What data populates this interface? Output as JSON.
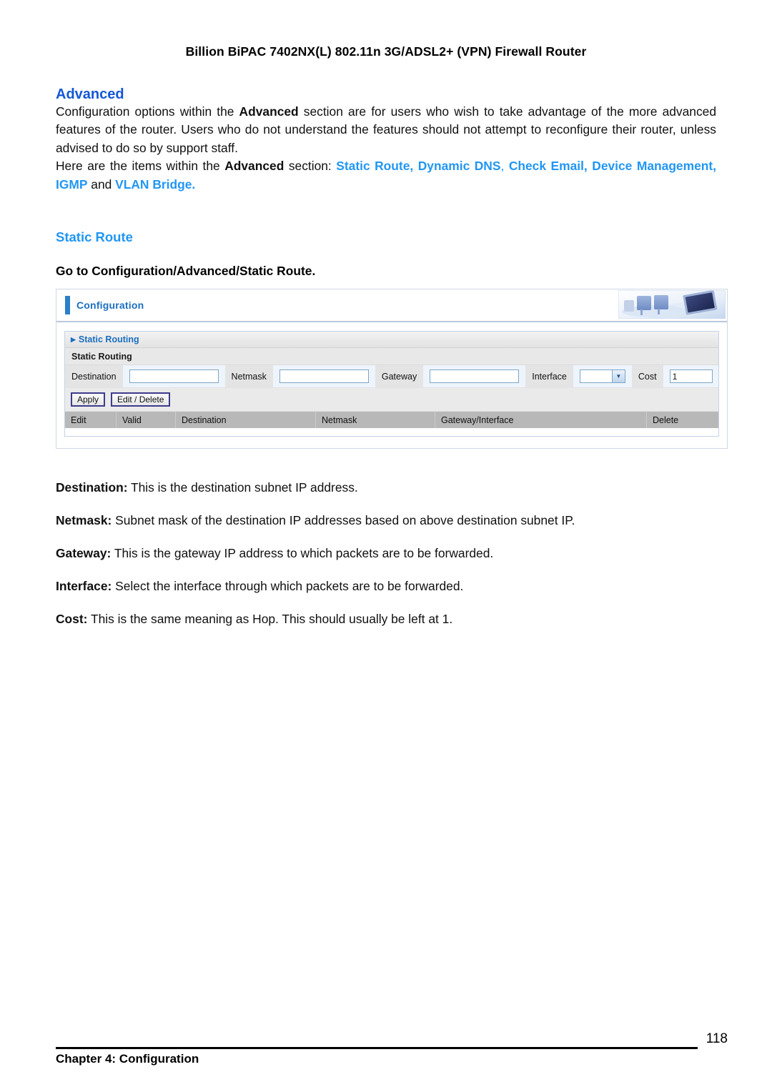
{
  "document": {
    "running_header": "Billion BiPAC 7402NX(L) 802.11n 3G/ADSL2+ (VPN) Firewall Router",
    "section_title": "Advanced",
    "intro_paragraph": "Configuration options within the Advanced section are for users who wish to take advantage of the more advanced features of the router. Users who do not understand the features should not attempt to reconfigure their router, unless advised to do so by support staff.",
    "intro_parts": {
      "a": "Configuration options within the ",
      "b": "Advanced",
      "c": " section are for users who wish to take advantage of the more advanced features of the router. Users who do not understand the features should not attempt to reconfigure their router, unless advised to do so by support staff."
    },
    "items_paragraph": {
      "lead": "Here are the items within the ",
      "bold": "Advanced",
      "mid": " section: ",
      "links": [
        "Static Route,",
        "Dynamic DNS",
        "Check Email,",
        "Device Management,",
        "IGMP"
      ],
      "comma": ",",
      "and": " and ",
      "last_link": "VLAN Bridge."
    },
    "static_route_heading": "Static Route",
    "goto_line": "Go to Configuration/Advanced/Static Route."
  },
  "router_ui": {
    "titlebar": "Configuration",
    "breadcrumb": "Static Routing",
    "section_label": "Static Routing",
    "form": {
      "destination": {
        "label": "Destination",
        "value": "",
        "placeholder": ""
      },
      "netmask": {
        "label": "Netmask",
        "value": "",
        "placeholder": ""
      },
      "gateway": {
        "label": "Gateway",
        "value": "",
        "placeholder": ""
      },
      "interface": {
        "label": "Interface",
        "value": "",
        "options": [
          ""
        ]
      },
      "cost": {
        "label": "Cost",
        "value": "1"
      }
    },
    "buttons": {
      "apply": "Apply",
      "edit_delete": "Edit / Delete"
    },
    "table": {
      "columns": [
        "Edit",
        "Valid",
        "Destination",
        "Netmask",
        "Gateway/Interface",
        "Delete"
      ],
      "rows": []
    }
  },
  "definitions": [
    {
      "term": "Destination:",
      "text": " This is the destination subnet IP address."
    },
    {
      "term": "Netmask:",
      "text": " Subnet mask of the destination IP addresses based on above destination subnet IP."
    },
    {
      "term": "Gateway:",
      "text": " This is the gateway IP address to which packets are to be forwarded."
    },
    {
      "term": "Interface:",
      "text": " Select the interface through which packets are to be forwarded."
    },
    {
      "term": "Cost:",
      "text": " This is the same meaning as Hop. This should usually be left at 1."
    }
  ],
  "footer": {
    "chapter": "Chapter 4: Configuration",
    "page_number": "118"
  },
  "colors": {
    "heading_blue": "#1357d6",
    "link_blue": "#2196f3",
    "ui_blue": "#1b6fc0",
    "accent_bar": "#2a7fc9"
  }
}
